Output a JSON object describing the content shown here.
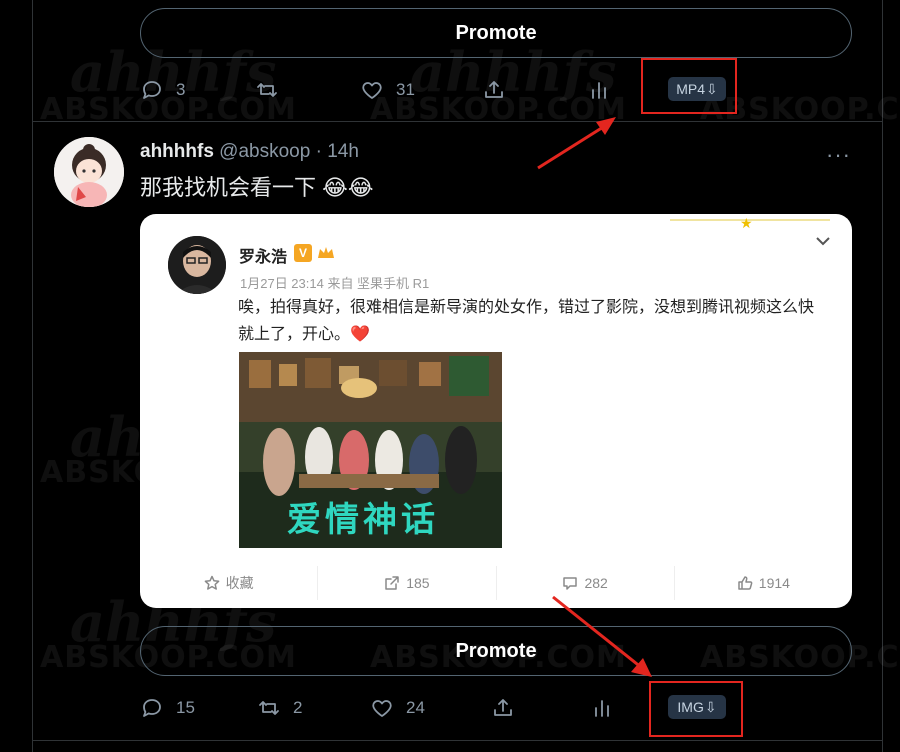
{
  "watermark": {
    "logo": "ahhhfs",
    "site": "ABSKOOP.COM"
  },
  "top_tweet": {
    "promote_label": "Promote",
    "actions": {
      "replies": "3",
      "retweets": "",
      "likes": "31"
    },
    "download_label": "MP4"
  },
  "tweet": {
    "display_name": "ahhhhfs",
    "handle": "@abskoop",
    "separator": "·",
    "time": "14h",
    "more_label": "···",
    "text": "那我找机会看一下 😂😂",
    "embed": {
      "author": "罗永浩",
      "verified_badge": "V",
      "meta": "1月27日 23:14 来自 坚果手机 R1",
      "body": "唉，拍得真好，很难相信是新导演的处女作，错过了影院，没想到腾讯视频这么快就上了，开心。❤️",
      "image_title": "爱情神话",
      "footer": [
        {
          "icon": "star-icon",
          "label": "收藏"
        },
        {
          "icon": "share-icon",
          "label": "185"
        },
        {
          "icon": "comment-icon",
          "label": "282"
        },
        {
          "icon": "thumbs-up-icon",
          "label": "1914"
        }
      ]
    },
    "promote_label": "Promote",
    "actions": {
      "replies": "15",
      "retweets": "2",
      "likes": "24"
    },
    "download_label": "IMG"
  },
  "colors": {
    "background": "#000000",
    "muted": "#8b98a5",
    "annotation": "#e3261f",
    "download_bg": "#263445"
  }
}
